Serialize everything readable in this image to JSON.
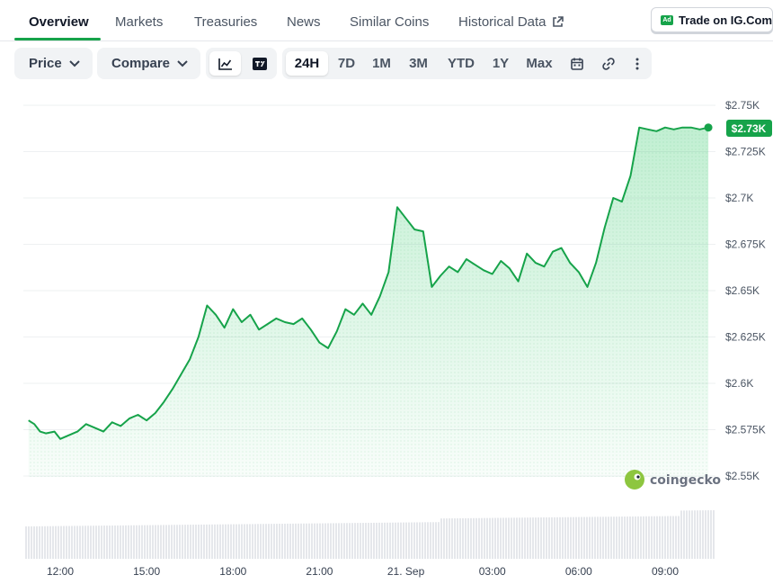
{
  "tabs": [
    {
      "label": "Overview",
      "active": true
    },
    {
      "label": "Markets"
    },
    {
      "label": "Treasuries"
    },
    {
      "label": "News"
    },
    {
      "label": "Similar Coins"
    },
    {
      "label": "Historical Data",
      "icon": "external-link-icon"
    }
  ],
  "ad_button": {
    "badge": "Ad",
    "label": "Trade on IG.Com"
  },
  "toolbar": {
    "price_label": "Price",
    "compare_label": "Compare",
    "chart_type_icons": [
      "line-chart-icon",
      "tradingview-icon"
    ],
    "ranges": [
      "24H",
      "7D",
      "1M",
      "3M",
      "YTD",
      "1Y",
      "Max"
    ],
    "selected_range": "24H",
    "extra_icons": [
      "calendar-icon",
      "link-icon",
      "more-vertical-icon"
    ]
  },
  "watermark": "coingecko",
  "colors": {
    "accent": "#16a34a",
    "line": "#16a34a",
    "fill": "#dcfce7",
    "volume": "#e5e7eb"
  },
  "chart_data": {
    "type": "area",
    "y_ticks": [
      "$2.55K",
      "$2.575K",
      "$2.6K",
      "$2.625K",
      "$2.65K",
      "$2.675K",
      "$2.7K",
      "$2.725K",
      "$2.75K"
    ],
    "ylim": [
      2540,
      2750
    ],
    "x_ticks": [
      "12:00",
      "15:00",
      "18:00",
      "21:00",
      "21. Sep",
      "03:00",
      "06:00",
      "09:00"
    ],
    "x_tick_hours": [
      12,
      15,
      18,
      21,
      24,
      27,
      30,
      33
    ],
    "current_price_label": "$2.73K",
    "series": [
      {
        "x": [
          10.9,
          11.1,
          11.3,
          11.5,
          11.8,
          12.0,
          12.3,
          12.6,
          12.9,
          13.2,
          13.5,
          13.8,
          14.1,
          14.4,
          14.7,
          15.0,
          15.3,
          15.6,
          15.9,
          16.2,
          16.5,
          16.8,
          17.1,
          17.4,
          17.7,
          18.0,
          18.3,
          18.6,
          18.9,
          19.2,
          19.5,
          19.8,
          20.1,
          20.4,
          20.7,
          21.0,
          21.3,
          21.6,
          21.9,
          22.2,
          22.5,
          22.8,
          23.1,
          23.4,
          23.7,
          24.0,
          24.3,
          24.6,
          24.9,
          25.2,
          25.5,
          25.8,
          26.1,
          26.4,
          26.7,
          27.0,
          27.3,
          27.6,
          27.9,
          28.2,
          28.5,
          28.8,
          29.1,
          29.4,
          29.7,
          30.0,
          30.3,
          30.6,
          30.9,
          31.2,
          31.5,
          31.8,
          32.1,
          32.4,
          32.7,
          33.0,
          33.3,
          33.6,
          33.9,
          34.2,
          34.5
        ],
        "y": [
          2580,
          2578,
          2574,
          2573,
          2574,
          2570,
          2572,
          2574,
          2578,
          2576,
          2574,
          2579,
          2577,
          2581,
          2583,
          2580,
          2584,
          2590,
          2597,
          2605,
          2613,
          2625,
          2642,
          2637,
          2630,
          2640,
          2633,
          2637,
          2629,
          2632,
          2635,
          2633,
          2632,
          2635,
          2629,
          2622,
          2619,
          2628,
          2640,
          2637,
          2643,
          2637,
          2647,
          2660,
          2695,
          2689,
          2683,
          2682,
          2652,
          2658,
          2663,
          2660,
          2667,
          2664,
          2661,
          2659,
          2666,
          2662,
          2655,
          2670,
          2665,
          2663,
          2671,
          2673,
          2665,
          2660,
          2652,
          2665,
          2684,
          2700,
          2698,
          2712,
          2738,
          2737,
          2736,
          2738,
          2737,
          2738,
          2738,
          2737,
          2738
        ]
      }
    ]
  }
}
